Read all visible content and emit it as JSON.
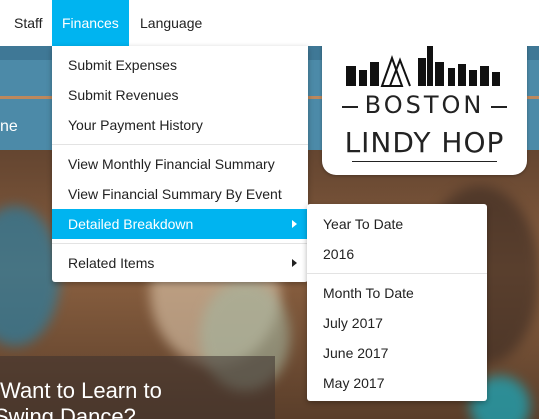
{
  "nav": {
    "items": [
      {
        "label": "Staff"
      },
      {
        "label": "Finances"
      },
      {
        "label": "Language"
      }
    ]
  },
  "banner": {
    "text_fragment": "ne"
  },
  "hero": {
    "line1": "Want to Learn to",
    "line2": "Swing Dance?"
  },
  "logo": {
    "line1": "BOSTON",
    "line2": "LINDY HOP"
  },
  "finances_menu": {
    "items": [
      {
        "label": "Submit Expenses"
      },
      {
        "label": "Submit Revenues"
      },
      {
        "label": "Your Payment History"
      },
      {
        "label": "View Monthly Financial Summary"
      },
      {
        "label": "View Financial Summary By Event"
      },
      {
        "label": "Detailed Breakdown"
      },
      {
        "label": "Related Items"
      }
    ]
  },
  "breakdown_menu": {
    "items": [
      {
        "label": "Year To Date"
      },
      {
        "label": "2016"
      },
      {
        "label": "Month To Date"
      },
      {
        "label": "July 2017"
      },
      {
        "label": "June 2017"
      },
      {
        "label": "May 2017"
      }
    ]
  },
  "colors": {
    "accent": "#00b4f0",
    "banner": "#4c8aa8"
  },
  "icons": {
    "submenu": "chevron-right-icon",
    "logo": "skyline-icon"
  }
}
